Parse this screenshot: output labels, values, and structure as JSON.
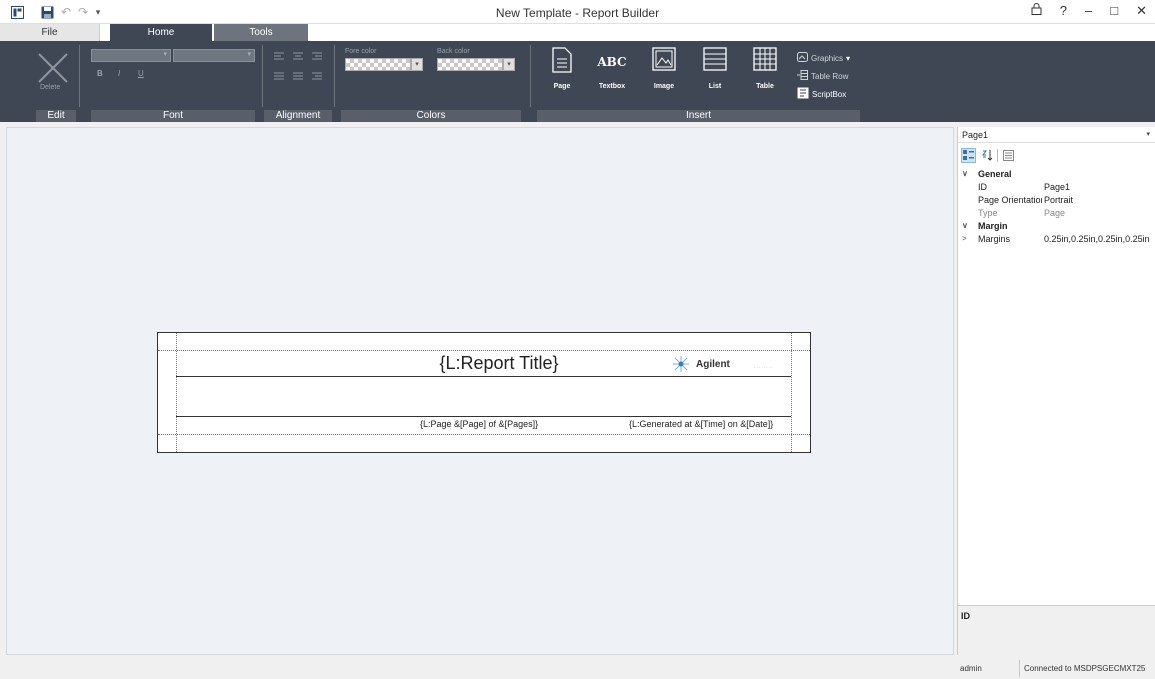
{
  "app": {
    "title": "New Template - Report Builder"
  },
  "tabs": {
    "file": "File",
    "home": "Home",
    "tools": "Tools"
  },
  "ribbon": {
    "edit": {
      "delete_label": "Delete",
      "group": "Edit"
    },
    "font": {
      "bold": "B",
      "italic": "I",
      "underline": "U",
      "group": "Font"
    },
    "alignment": {
      "group": "Alignment"
    },
    "colors": {
      "fore_label": "Fore color",
      "back_label": "Back color",
      "group": "Colors"
    },
    "insert": {
      "page": "Page",
      "textbox": "Textbox",
      "textbox_glyph": "ABC",
      "image": "Image",
      "list": "List",
      "table": "Table",
      "graphics": "Graphics",
      "table_row": "Table Row",
      "scriptbox": "ScriptBox",
      "group": "Insert"
    }
  },
  "report": {
    "title": "{L:Report Title}",
    "logo_text": "Agilent",
    "page_footer": "{L:Page &[Page] of &[Pages]}",
    "generated_footer": "{L:Generated at &[Time] on &[Date]}"
  },
  "properties": {
    "selected_object": "Page1",
    "general_label": "General",
    "rows": [
      {
        "name": "ID",
        "value": "Page1"
      },
      {
        "name": "Page Orientation",
        "value": "Portrait"
      },
      {
        "name": "Type",
        "value": "Page"
      }
    ],
    "margin_label": "Margin",
    "margins": {
      "name": "Margins",
      "value": "0.25in,0.25in,0.25in,0.25in"
    },
    "description_title": "ID"
  },
  "status": {
    "user": "admin",
    "connection": "Connected to MSDPSGECMXT25"
  },
  "colors": {
    "ribbon": "#3e4753",
    "group_label": "#585f69",
    "canvas": "#eef1f6",
    "accent": "#2e4a6b"
  }
}
